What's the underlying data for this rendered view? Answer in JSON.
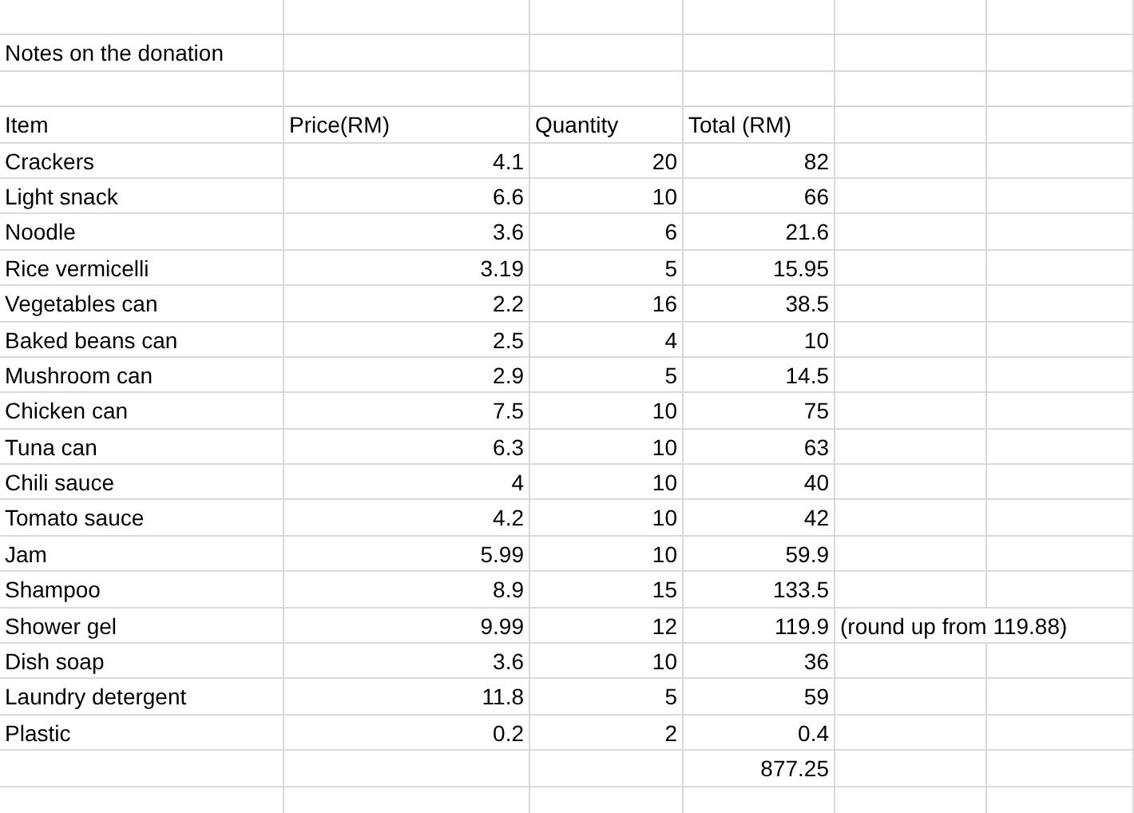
{
  "title": "Notes on the donation",
  "columns": [
    "Item",
    "Price(RM)",
    "Quantity",
    "Total (RM)"
  ],
  "rows": [
    {
      "item": "Crackers",
      "price": "4.1",
      "quantity": "20",
      "total": "82"
    },
    {
      "item": "Light snack",
      "price": "6.6",
      "quantity": "10",
      "total": "66"
    },
    {
      "item": "Noodle",
      "price": "3.6",
      "quantity": "6",
      "total": "21.6"
    },
    {
      "item": "Rice vermicelli",
      "price": "3.19",
      "quantity": "5",
      "total": "15.95"
    },
    {
      "item": "Vegetables can",
      "price": "2.2",
      "quantity": "16",
      "total": "38.5"
    },
    {
      "item": "Baked beans can",
      "price": "2.5",
      "quantity": "4",
      "total": "10"
    },
    {
      "item": "Mushroom can",
      "price": "2.9",
      "quantity": "5",
      "total": "14.5"
    },
    {
      "item": "Chicken can",
      "price": "7.5",
      "quantity": "10",
      "total": "75"
    },
    {
      "item": "Tuna can",
      "price": "6.3",
      "quantity": "10",
      "total": "63"
    },
    {
      "item": "Chili sauce",
      "price": "4",
      "quantity": "10",
      "total": "40"
    },
    {
      "item": "Tomato sauce",
      "price": "4.2",
      "quantity": "10",
      "total": "42"
    },
    {
      "item": "Jam",
      "price": "5.99",
      "quantity": "10",
      "total": "59.9"
    },
    {
      "item": "Shampoo",
      "price": "8.9",
      "quantity": "15",
      "total": "133.5"
    },
    {
      "item": "Shower gel",
      "price": "9.99",
      "quantity": "12",
      "total": "119.9",
      "note": "(round up from 119.88)"
    },
    {
      "item": "Dish soap",
      "price": "3.6",
      "quantity": "10",
      "total": "36"
    },
    {
      "item": "Laundry detergent",
      "price": "11.8",
      "quantity": "5",
      "total": "59"
    },
    {
      "item": "Plastic",
      "price": "0.2",
      "quantity": "2",
      "total": "0.4"
    }
  ],
  "grand_total": "877.25"
}
